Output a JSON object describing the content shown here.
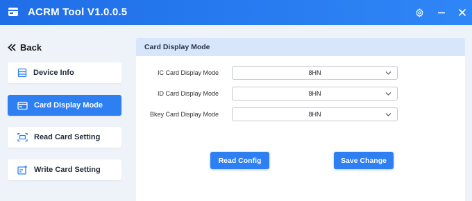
{
  "window": {
    "title": "ACRM Tool V1.0.0.5",
    "icons": [
      "app-icon",
      "gear-icon",
      "minimize-icon",
      "close-icon"
    ]
  },
  "sidebar": {
    "back_label": "Back",
    "items": [
      {
        "label": "Device Info",
        "icon": "device-info-icon",
        "active": false
      },
      {
        "label": "Card Display Mode",
        "icon": "card-display-icon",
        "active": true
      },
      {
        "label": "Read Card Setting",
        "icon": "read-card-icon",
        "active": false
      },
      {
        "label": "Write Card Setting",
        "icon": "write-card-icon",
        "active": false
      }
    ]
  },
  "panel": {
    "title": "Card Display Mode",
    "fields": [
      {
        "label": "IC Card Display Mode",
        "value": "8HN"
      },
      {
        "label": "ID Card Display Mode",
        "value": "8HN"
      },
      {
        "label": "Bkey Card Display Mode",
        "value": "8HN"
      }
    ],
    "read_button": "Read Config",
    "save_button": "Save Change"
  },
  "colors": {
    "accent": "#2d7ff2",
    "titlebar": "#1f6ee8",
    "panel_header": "#d7e6fb",
    "background": "#eef2f9"
  }
}
